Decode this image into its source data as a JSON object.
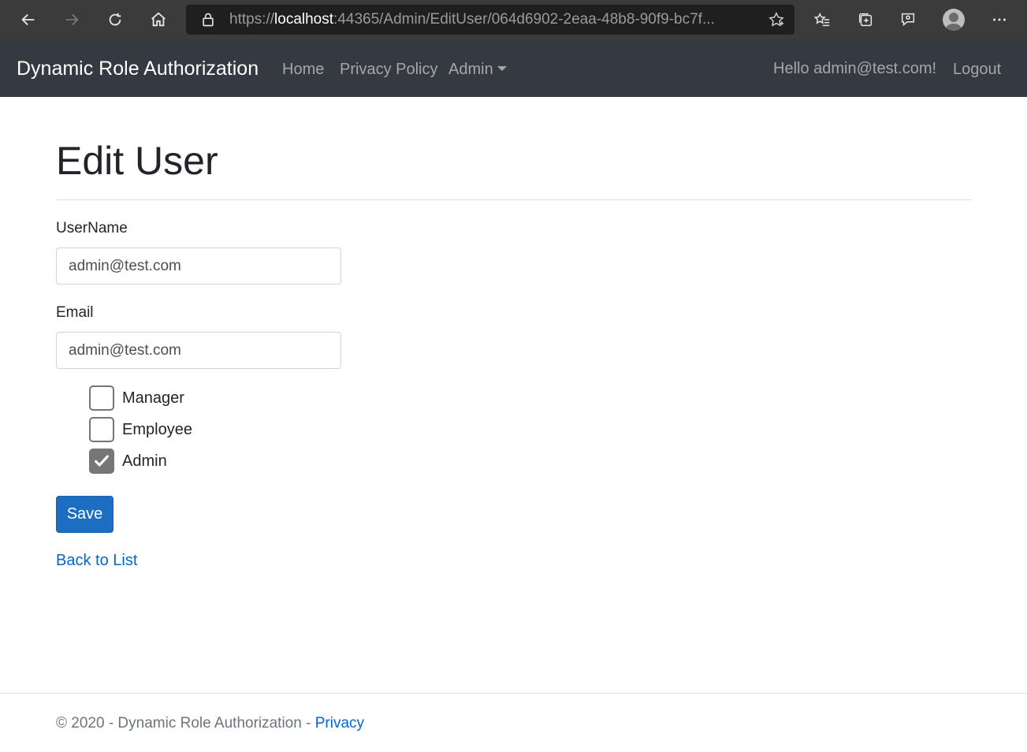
{
  "browser": {
    "url_scheme": "https://",
    "url_host": "localhost",
    "url_rest": ":44365/Admin/EditUser/064d6902-2eaa-48b8-90f9-bc7f..."
  },
  "navbar": {
    "brand": "Dynamic Role Authorization",
    "links": [
      "Home",
      "Privacy Policy",
      "Admin"
    ],
    "greeting": "Hello admin@test.com!",
    "logout": "Logout"
  },
  "main": {
    "title": "Edit User",
    "username_label": "UserName",
    "username_value": "admin@test.com",
    "email_label": "Email",
    "email_value": "admin@test.com",
    "roles": [
      {
        "label": "Manager",
        "checked": false
      },
      {
        "label": "Employee",
        "checked": false
      },
      {
        "label": "Admin",
        "checked": true
      }
    ],
    "save_label": "Save",
    "back_label": "Back to List"
  },
  "footer": {
    "text": "© 2020 - Dynamic Role Authorization - ",
    "link": "Privacy"
  },
  "colors": {
    "navbar_bg": "#343a40",
    "primary_button": "#1b6ec2",
    "link": "#0366d6",
    "checkbox_checked": "#767676"
  }
}
